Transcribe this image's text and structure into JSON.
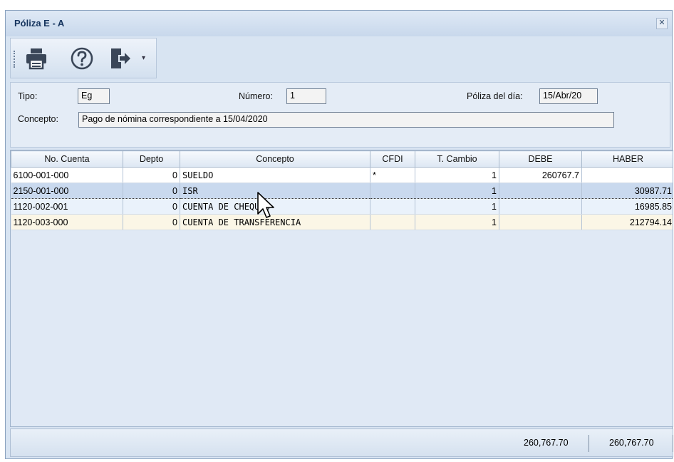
{
  "window": {
    "title": "Póliza E - A",
    "close_glyph": "✕"
  },
  "toolbar": {
    "dropdown_glyph": "▾",
    "icons": [
      "print-icon",
      "help-icon",
      "exit-icon"
    ]
  },
  "form": {
    "tipo_label": "Tipo:",
    "tipo_value": "Eg",
    "numero_label": "Número:",
    "numero_value": "1",
    "fecha_label": "Póliza del día:",
    "fecha_value": "15/Abr/20",
    "concepto_label": "Concepto:",
    "concepto_value": "Pago de nómina correspondiente a 15/04/2020"
  },
  "grid": {
    "columns": [
      "No. Cuenta",
      "Depto",
      "Concepto",
      "CFDI",
      "T. Cambio",
      "DEBE",
      "HABER"
    ],
    "rows": [
      {
        "cuenta": "6100-001-000",
        "depto": "0",
        "concepto": "SUELDO",
        "cfdi": "*",
        "tcambio": "1",
        "debe": "260767.7",
        "haber": ""
      },
      {
        "cuenta": "2150-001-000",
        "depto": "0",
        "concepto": "ISR",
        "cfdi": "",
        "tcambio": "1",
        "debe": "",
        "haber": "30987.71"
      },
      {
        "cuenta": "1120-002-001",
        "depto": "0",
        "concepto": "CUENTA DE CHEQUES",
        "cfdi": "",
        "tcambio": "1",
        "debe": "",
        "haber": "16985.85"
      },
      {
        "cuenta": "1120-003-000",
        "depto": "0",
        "concepto": "CUENTA DE TRANSFERENCIA",
        "cfdi": "",
        "tcambio": "1",
        "debe": "",
        "haber": "212794.14"
      }
    ]
  },
  "totals": {
    "debe": "260,767.70",
    "haber": "260,767.70"
  },
  "colors": {
    "window_bg": "#d8e4f2",
    "title": "#15345e",
    "selected_row": "#c9d9ee"
  }
}
